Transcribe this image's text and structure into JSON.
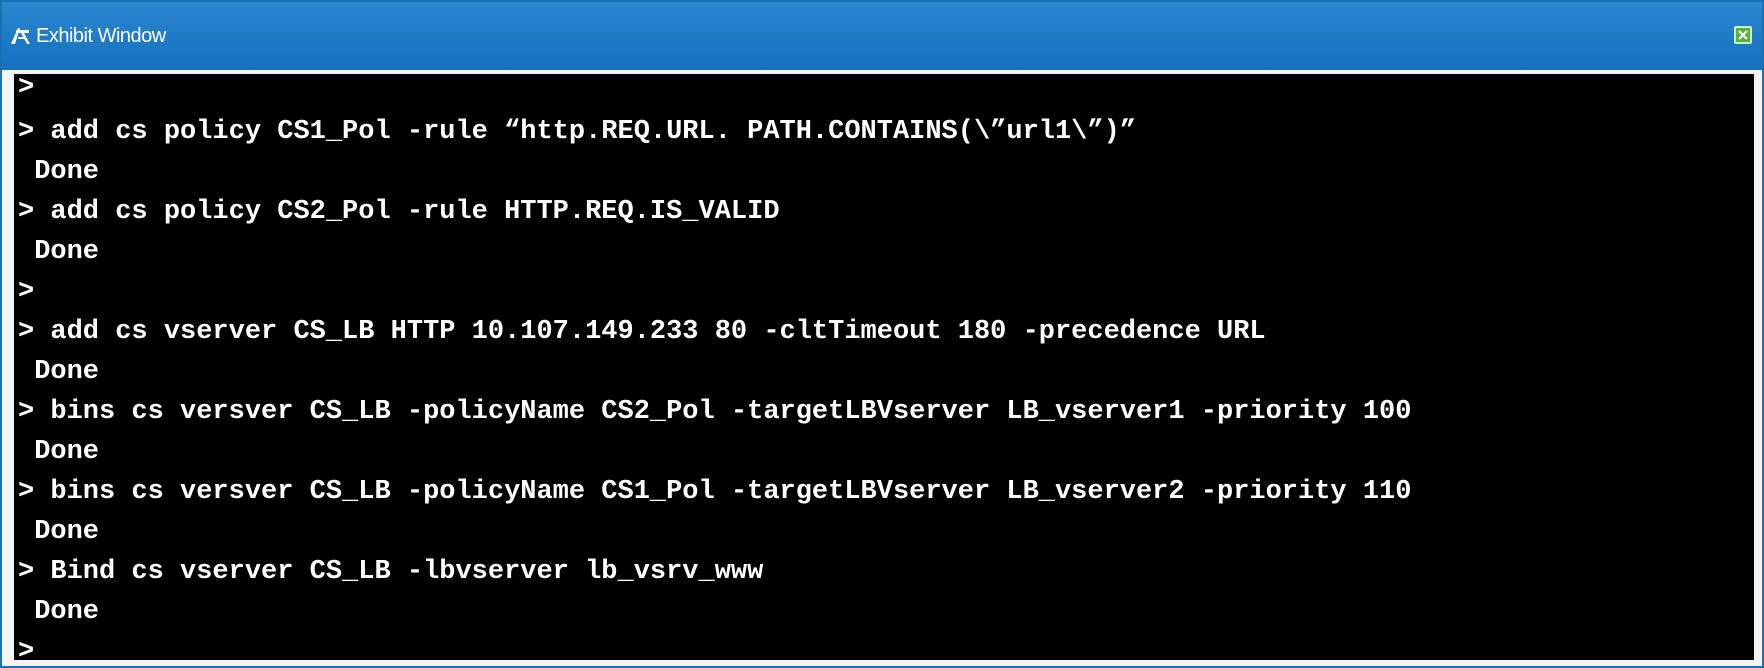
{
  "window": {
    "title": "Exhibit Window",
    "icon": "exhibit-icon",
    "close_icon": "close-icon",
    "accent_color": "#1571bd",
    "close_color": "#56b43a"
  },
  "terminal": {
    "background": "#000000",
    "text_color": "#ffffff",
    "lines": [
      ">",
      "> add cs policy CS1_Pol -rule “http.REQ.URL. PATH.CONTAINS(\\”url1\\”)”",
      " Done",
      "> add cs policy CS2_Pol -rule HTTP.REQ.IS_VALID",
      " Done",
      ">",
      "> add cs vserver CS_LB HTTP 10.107.149.233 80 -cltTimeout 180 -precedence URL",
      " Done",
      "> bins cs versver CS_LB -policyName CS2_Pol -targetLBVserver LB_vserver1 -priority 100",
      " Done",
      "> bins cs versver CS_LB -policyName CS1_Pol -targetLBVserver LB_vserver2 -priority 110",
      " Done",
      "> Bind cs vserver CS_LB -lbvserver lb_vsrv_www",
      " Done",
      ">"
    ]
  }
}
